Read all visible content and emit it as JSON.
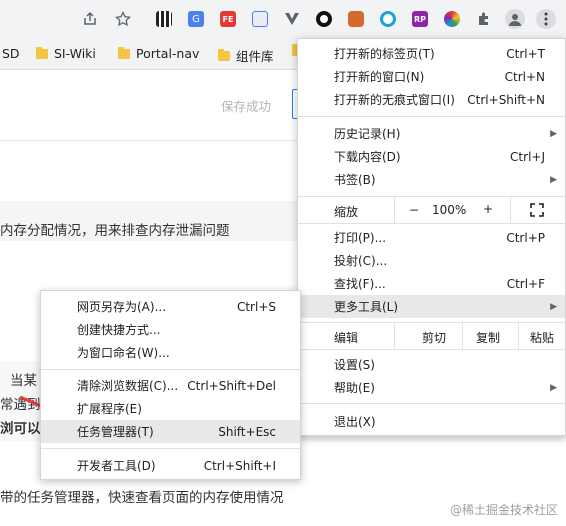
{
  "colors": {
    "accent": "#1e80ff",
    "arrow": "#e53935",
    "menu_highlight": "#e8e8e8"
  },
  "toolbar": {
    "icons": [
      "share-icon",
      "star-icon",
      "qr-extension-icon",
      "translate-extension-icon",
      "fe-extension-icon",
      "image-extension-icon",
      "vue-extension-icon",
      "circle-extension-icon",
      "fox-extension-icon",
      "refresh-extension-icon",
      "rp-extension-icon",
      "color-extension-icon",
      "puzzle-extension-icon",
      "profile-icon",
      "more-menu-icon"
    ],
    "rp_label": "RP",
    "fe_label": "FE"
  },
  "bookmarks": [
    {
      "label": "SD"
    },
    {
      "label": "SI-Wiki"
    },
    {
      "label": "Portal-nav"
    },
    {
      "label": "组件库"
    }
  ],
  "page": {
    "save_status": "保存成功",
    "line1": "内存分配情况，用来排查内存泄漏问题",
    "line2_a": "当某",
    "line2_b": "常遇到",
    "line2_c": "浏可以",
    "bottom_line": "带的任务管理器，快速查看页面的内存使用情况"
  },
  "chrome_menu": {
    "items_top": [
      {
        "label": "打开新的标签页(T)",
        "shortcut": "Ctrl+T"
      },
      {
        "label": "打开新的窗口(N)",
        "shortcut": "Ctrl+N"
      },
      {
        "label": "打开新的无痕式窗口(I)",
        "shortcut": "Ctrl+Shift+N"
      }
    ],
    "items_mid": [
      {
        "label": "历史记录(H)",
        "shortcut": ""
      },
      {
        "label": "下载内容(D)",
        "shortcut": "Ctrl+J"
      },
      {
        "label": "书签(B)",
        "shortcut": ""
      }
    ],
    "zoom": {
      "label": "缩放",
      "minus": "−",
      "value": "100%",
      "plus": "+"
    },
    "items_tools": [
      {
        "label": "打印(P)...",
        "shortcut": "Ctrl+P"
      },
      {
        "label": "投射(C)...",
        "shortcut": ""
      },
      {
        "label": "查找(F)...",
        "shortcut": "Ctrl+F"
      },
      {
        "label": "更多工具(L)",
        "shortcut": ""
      }
    ],
    "edit": {
      "label": "编辑",
      "cut": "剪切",
      "copy": "复制",
      "paste": "粘贴"
    },
    "items_bottom": [
      {
        "label": "设置(S)",
        "shortcut": ""
      },
      {
        "label": "帮助(E)",
        "shortcut": ""
      }
    ],
    "exit": {
      "label": "退出(X)"
    }
  },
  "submenu": {
    "group1": [
      {
        "label": "网页另存为(A)...",
        "shortcut": "Ctrl+S"
      },
      {
        "label": "创建快捷方式...",
        "shortcut": ""
      },
      {
        "label": "为窗口命名(W)...",
        "shortcut": ""
      }
    ],
    "group2": [
      {
        "label": "清除浏览数据(C)...",
        "shortcut": "Ctrl+Shift+Del"
      },
      {
        "label": "扩展程序(E)",
        "shortcut": ""
      },
      {
        "label": "任务管理器(T)",
        "shortcut": "Shift+Esc"
      }
    ],
    "group3": [
      {
        "label": "开发者工具(D)",
        "shortcut": "Ctrl+Shift+I"
      }
    ]
  },
  "watermark": "@稀土掘金技术社区"
}
